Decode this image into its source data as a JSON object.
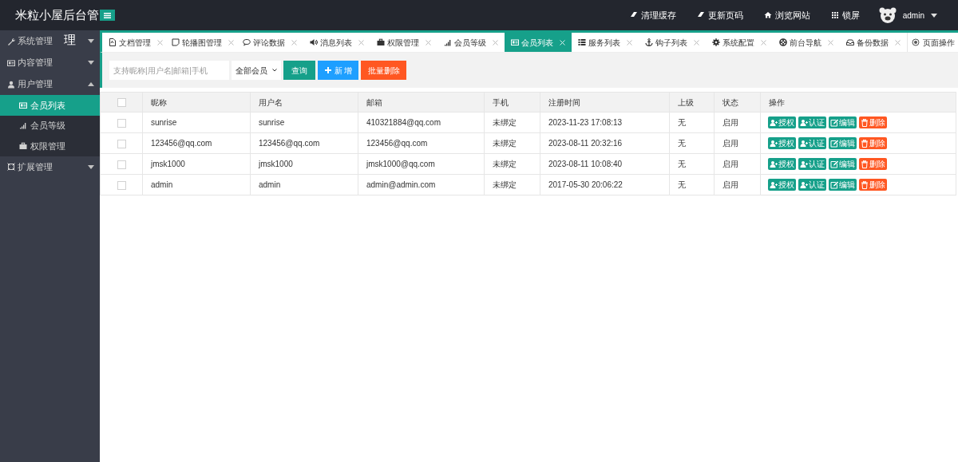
{
  "header": {
    "brand": "米粒小屋后台管",
    "brand_overflow": "理",
    "actions": [
      {
        "kind": "eraser",
        "label": "清理缓存"
      },
      {
        "kind": "eraser",
        "label": "更新页码"
      },
      {
        "kind": "home",
        "label": "浏览网站"
      },
      {
        "kind": "grid",
        "label": "锁屏"
      }
    ],
    "user": "admin"
  },
  "sidebar": {
    "items": [
      {
        "kind": "wrench",
        "label": "系统管理",
        "expanded": false
      },
      {
        "kind": "card",
        "label": "内容管理",
        "expanded": false
      },
      {
        "kind": "user",
        "label": "用户管理",
        "expanded": true,
        "children": [
          {
            "kind": "card",
            "label": "会员列表",
            "selected": true
          },
          {
            "kind": "signal",
            "label": "会员等级",
            "selected": false
          },
          {
            "kind": "case",
            "label": "权限管理",
            "selected": false
          }
        ]
      },
      {
        "kind": "expand",
        "label": "扩展管理",
        "expanded": false
      }
    ]
  },
  "tabs": [
    {
      "kind": "file",
      "label": "文档管理",
      "selected": false
    },
    {
      "kind": "note",
      "label": "轮播图管理",
      "selected": false
    },
    {
      "kind": "chat",
      "label": "评论数据",
      "selected": false
    },
    {
      "kind": "speaker",
      "label": "消息列表",
      "selected": false
    },
    {
      "kind": "case",
      "label": "权限管理",
      "selected": false
    },
    {
      "kind": "signal",
      "label": "会员等级",
      "selected": false
    },
    {
      "kind": "card",
      "label": "会员列表",
      "selected": true
    },
    {
      "kind": "list",
      "label": "服务列表",
      "selected": false
    },
    {
      "kind": "anchor",
      "label": "钩子列表",
      "selected": false
    },
    {
      "kind": "gear",
      "label": "系统配置",
      "selected": false
    },
    {
      "kind": "lifebuoy",
      "label": "前台导航",
      "selected": false
    },
    {
      "kind": "inbox",
      "label": "备份数据",
      "selected": false
    }
  ],
  "page_ops": "页面操作",
  "toolbar": {
    "search_placeholder": "支持昵称|用户名|邮箱|手机",
    "filter": "全部会员",
    "buttons": [
      {
        "kind": "query",
        "label": "查询"
      },
      {
        "kind": "add",
        "label": "新 增"
      },
      {
        "kind": "delete",
        "label": "批量删除"
      }
    ]
  },
  "table": {
    "select_all": {
      "checked": false
    },
    "columns": [
      "昵称",
      "用户名",
      "邮箱",
      "手机",
      "注册时间",
      "上级",
      "状态",
      "操作"
    ],
    "rows": [
      {
        "checked": false,
        "cells": [
          "sunrise",
          "sunrise",
          "410321884@qq.com",
          "未绑定",
          "2023-11-23 17:08:13",
          "无",
          "启用"
        ],
        "actions": [
          {
            "kind": "grant",
            "label": "授权"
          },
          {
            "kind": "verify",
            "label": "认证"
          },
          {
            "kind": "edit",
            "label": "编辑"
          },
          {
            "kind": "delete",
            "label": "删除"
          }
        ]
      },
      {
        "checked": false,
        "cells": [
          "123456@qq.com",
          "123456@qq.com",
          "123456@qq.com",
          "未绑定",
          "2023-08-11 20:32:16",
          "无",
          "启用"
        ],
        "actions": [
          {
            "kind": "grant",
            "label": "授权"
          },
          {
            "kind": "verify",
            "label": "认证"
          },
          {
            "kind": "edit",
            "label": "编辑"
          },
          {
            "kind": "delete",
            "label": "删除"
          }
        ]
      },
      {
        "checked": false,
        "cells": [
          "jmsk1000",
          "jmsk1000",
          "jmsk1000@qq.com",
          "未绑定",
          "2023-08-11 10:08:40",
          "无",
          "启用"
        ],
        "actions": [
          {
            "kind": "grant",
            "label": "授权"
          },
          {
            "kind": "verify",
            "label": "认证"
          },
          {
            "kind": "edit",
            "label": "编辑"
          },
          {
            "kind": "delete",
            "label": "删除"
          }
        ]
      },
      {
        "checked": false,
        "cells": [
          "admin",
          "admin",
          "admin@admin.com",
          "未绑定",
          "2017-05-30 20:06:22",
          "无",
          "启用"
        ],
        "actions": [
          {
            "kind": "grant",
            "label": "授权"
          },
          {
            "kind": "verify",
            "label": "认证"
          },
          {
            "kind": "edit",
            "label": "编辑"
          },
          {
            "kind": "delete",
            "label": "删除"
          }
        ]
      }
    ]
  }
}
